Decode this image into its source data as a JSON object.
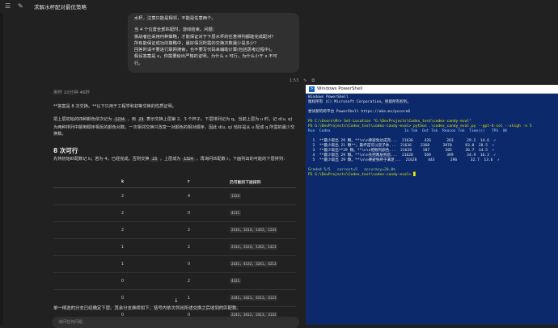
{
  "chat": {
    "title": "求解水杯配对最优策略",
    "prompt_lines": [
      "水杯，注意只能是相邻，不能是任意两个。",
      "当 4 个位置全部匹配时，游戏结束。问题：",
      "挑战者应采用何种策略，才能保证对于下层水杯的任意排列都能完成配对？",
      "所有能保证成功的策略中，最好情况所需的交换次数最少是多少？",
      "回答时请不要进行联网搜索，也不要写代码来辅助计算(包括思考过程中)。",
      "假设答案是 x，你需要给出严格的证明，为什么 x 可行，为什么小于 x 不可",
      "行。"
    ],
    "timestamp": "1:53",
    "thought": "用时 10分钟 46秒",
    "answer_1": "**答案是 8 次交换。**以下只用于工程学和初等交换的性质证明。",
    "answer_2a": "把上层初始的四种颜色依次记为",
    "answer_2b": "，用",
    "answer_2c": "表示交换上层第 2、3 个杯子。下层排列记为 q。当前上层为 u 时，记 d(u, q) 为两种排列中颠倒顺序相反的颜色对数。一次相邻交换只改变一对颜色的相对顺序，因此 d(u, q) 恰好是从 u 配成 q 所需的最少交换数。",
    "code_1": "1234",
    "code_2": "23",
    "heading": "8 次可行",
    "answer_3a": "先将初始匹配数记 k；若为 4，已经完成。否则交换",
    "answer_3b": "，上层成为",
    "answer_3c": "，再询问匹配数 r。下面列出的可能的下层排列：",
    "code_3": "23",
    "code_4": "1324",
    "table": {
      "headers": [
        "k",
        "r",
        "仍可能的下层排列"
      ],
      "rows": [
        {
          "k": "2",
          "r": "4",
          "perms": "1324"
        },
        {
          "k": "2",
          "r": "0",
          "perms": "4231"
        },
        {
          "k": "2",
          "r": "2",
          "perms": "2134, 3214, 1432, 1243"
        },
        {
          "k": "1",
          "r": "2",
          "perms": "2314, 3124, 1342, 1423"
        },
        {
          "k": "1",
          "r": "0",
          "perms": "2431, 4132, 3241, 4213"
        },
        {
          "k": "0",
          "r": "2",
          "perms": "4321"
        },
        {
          "k": "0",
          "r": "1",
          "perms": "2341, 3421, 4312, 4123"
        },
        {
          "k": "0",
          "r": "0",
          "perms": "2143, 3412, 2413, 3142"
        }
      ]
    },
    "summary": "单一候选的分支已经确定下层。其余分支继续如下，括号内依次列出所述交换之后收到的匹配数。",
    "composer_placeholder": "询问任何问题"
  },
  "terminal": {
    "window_title": "Windows PowerShell",
    "lines": [
      {
        "t": "Windows PowerShell",
        "cls": ""
      },
      {
        "t": "版权所有 (C) Microsoft Corporation。保留所有权利。",
        "cls": ""
      },
      {
        "t": "",
        "cls": ""
      },
      {
        "t": "尝试新的跨平台 PowerShell https://aka.ms/pscore6",
        "cls": ""
      },
      {
        "t": "",
        "cls": ""
      },
      {
        "t": "PS C:\\Users\\Mr> Set-Location \"G:\\DevProjects\\Codex_test\\codex-candy-eval\"",
        "cls": "y"
      },
      {
        "t": "PS G:\\DevProjects\\Codex_test\\codex-candy-eval> python .\\codex_candy_eval.py --gpt-6-sol --xhigh -n 5",
        "cls": "y"
      },
      {
        "t": "Run  Codex                                 In Tok  Out Tok  Reason Tok  Time(s)   TPS  OK",
        "cls": "c"
      },
      {
        "t": "",
        "cls": ""
      },
      {
        "t": "  1  **最少取出 29 颗。**\\n\\n要避免达成完...  21636     426       283      29.2  14.6  ✓",
        "cls": ""
      },
      {
        "t": "  2  **最少取出 21 颗**。最坏是可以逆子体...  21636    2368      2070      83.0  28.5  ✓",
        "cls": ""
      },
      {
        "t": "  3  **最少取出**29 颗。**\\n\\n把散列颜色...  21628     387       205      26.7  14.5  ✓",
        "cls": ""
      },
      {
        "t": "  4  **最少取出 29 颗。**\\n\\n先把两层构造...  21628     569       399      34.9  16.3  ✓",
        "cls": ""
      },
      {
        "t": "  5  **最少取出 29 颗。**\\n\\n要避免终于满足...  21628     443       296      32.7  13.6  ✓",
        "cls": ""
      },
      {
        "t": "",
        "cls": ""
      },
      {
        "t": "Graded 5/5   correct=5   accuracy=20.0%",
        "cls": "g"
      },
      {
        "t": "PS G:\\DevProjects\\Codex_test\\codex-candy-eval> █",
        "cls": "y"
      }
    ]
  }
}
